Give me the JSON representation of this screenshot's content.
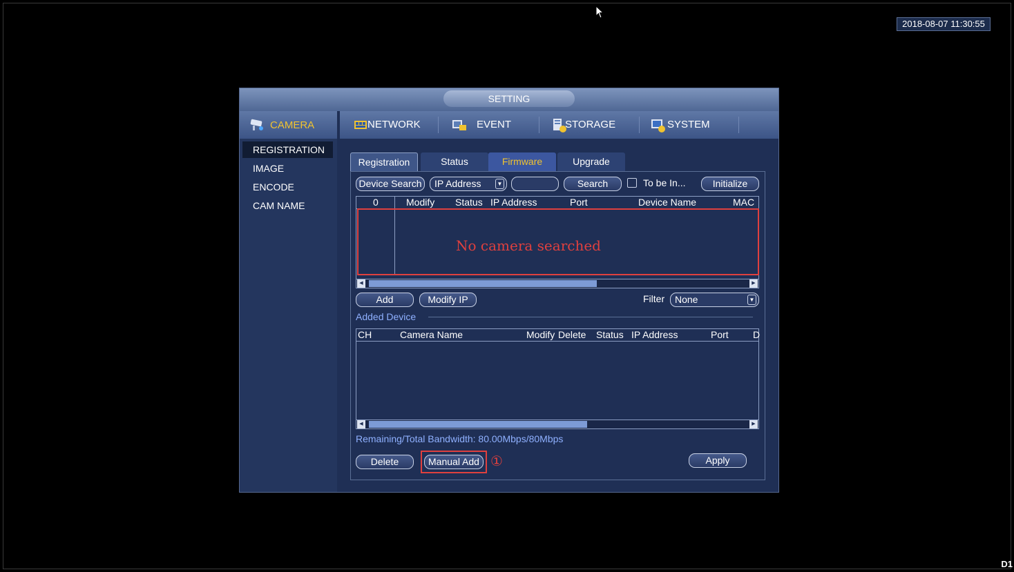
{
  "clock": "2018-08-07 11:30:55",
  "corner_label": "D1",
  "window": {
    "title": "SETTING"
  },
  "sidebar": {
    "header": "CAMERA",
    "header_icon": "camera-icon",
    "items": [
      {
        "label": "REGISTRATION",
        "active": true
      },
      {
        "label": "IMAGE",
        "active": false
      },
      {
        "label": "ENCODE",
        "active": false
      },
      {
        "label": "CAM NAME",
        "active": false
      }
    ]
  },
  "nav": [
    {
      "label": "NETWORK",
      "icon": "network-icon"
    },
    {
      "label": "EVENT",
      "icon": "event-icon"
    },
    {
      "label": "STORAGE",
      "icon": "storage-icon"
    },
    {
      "label": "SYSTEM",
      "icon": "system-icon"
    }
  ],
  "tabs": [
    {
      "label": "Registration",
      "active": true
    },
    {
      "label": "Status",
      "active": false
    },
    {
      "label": "Firmware",
      "active": false,
      "highlighted": true
    },
    {
      "label": "Upgrade",
      "active": false
    }
  ],
  "search_toolbar": {
    "device_search": "Device Search",
    "ip_type": "IP Address",
    "search": "Search",
    "to_be_init": "To be In...",
    "initialize": "Initialize"
  },
  "search_table": {
    "headers": [
      "0",
      "Modify",
      "Status",
      "IP Address",
      "Port",
      "Device Name",
      "MAC"
    ],
    "empty_message": "No camera searched"
  },
  "search_actions": {
    "add": "Add",
    "modify_ip": "Modify IP",
    "filter_label": "Filter",
    "filter_value": "None"
  },
  "added_device": {
    "title": "Added Device",
    "headers": [
      "CH",
      "Camera Name",
      "Modify",
      "Delete",
      "Status",
      "IP Address",
      "Port",
      "D"
    ]
  },
  "bandwidth": "Remaining/Total Bandwidth: 80.00Mbps/80Mbps",
  "bottom_actions": {
    "delete": "Delete",
    "manual_add": "Manual Add",
    "step_marker": "①",
    "apply": "Apply"
  },
  "colors": {
    "accent": "#f0c330",
    "annotation": "#e0403e",
    "panel": "#1f2f55"
  }
}
